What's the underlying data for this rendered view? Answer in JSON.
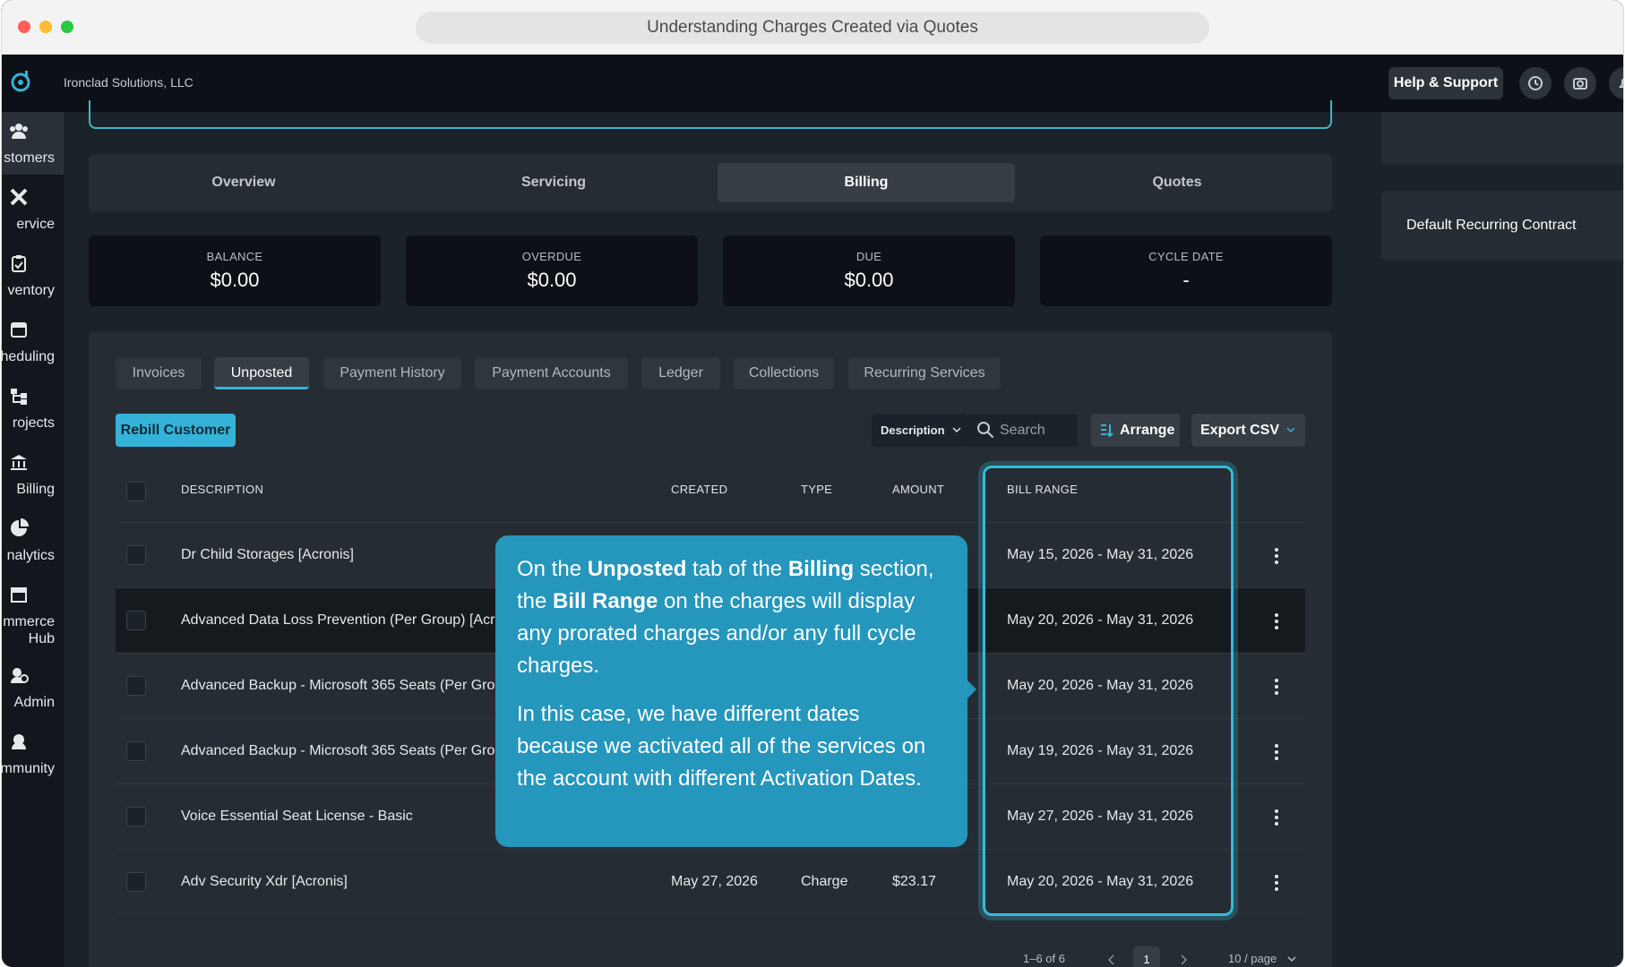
{
  "browser": {
    "title": "Understanding Charges Created via Quotes"
  },
  "header": {
    "company": "Ironclad Solutions, LLC",
    "help_label": "Help & Support",
    "icons": [
      "history-icon",
      "camera-icon",
      "notification-icon"
    ]
  },
  "sidebar": {
    "items": [
      {
        "label": "stomers",
        "icon": "customers-icon",
        "active": true
      },
      {
        "label": "ervice",
        "icon": "service-tools-icon"
      },
      {
        "label": "ventory",
        "icon": "inventory-clipboard-icon"
      },
      {
        "label": "heduling",
        "icon": "calendar-icon"
      },
      {
        "label": "rojects",
        "icon": "projects-hierarchy-icon"
      },
      {
        "label": "Billing",
        "icon": "bank-icon"
      },
      {
        "label": "nalytics",
        "icon": "pie-chart-icon"
      },
      {
        "label": "mmerce Hub",
        "icon": "store-icon"
      },
      {
        "label": "Admin",
        "icon": "admin-user-gear-icon"
      },
      {
        "label": "mmunity",
        "icon": "community-icon"
      }
    ]
  },
  "main_tabs": [
    {
      "label": "Overview"
    },
    {
      "label": "Servicing"
    },
    {
      "label": "Billing",
      "active": true
    },
    {
      "label": "Quotes"
    }
  ],
  "summary_cards": [
    {
      "label": "BALANCE",
      "value": "$0.00"
    },
    {
      "label": "OVERDUE",
      "value": "$0.00"
    },
    {
      "label": "DUE",
      "value": "$0.00"
    },
    {
      "label": "CYCLE DATE",
      "value": "-"
    }
  ],
  "sub_tabs": [
    {
      "label": "Invoices"
    },
    {
      "label": "Unposted",
      "active": true
    },
    {
      "label": "Payment History"
    },
    {
      "label": "Payment Accounts"
    },
    {
      "label": "Ledger"
    },
    {
      "label": "Collections"
    },
    {
      "label": "Recurring Services"
    }
  ],
  "toolbar": {
    "rebill_label": "Rebill Customer",
    "filter_field": "Description",
    "search_placeholder": "Search",
    "arrange_label": "Arrange",
    "export_label": "Export CSV"
  },
  "table": {
    "columns": [
      "DESCRIPTION",
      "CREATED",
      "TYPE",
      "AMOUNT",
      "BILL RANGE"
    ],
    "rows": [
      {
        "description": "Dr Child Storages [Acronis]",
        "created": "",
        "type": "",
        "amount": "",
        "bill_range": "May 15, 2026 - May 31, 2026"
      },
      {
        "description": "Advanced Data Loss Prevention (Per Group) [Acronis]",
        "created": "",
        "type": "",
        "amount": "",
        "bill_range": "May 20, 2026 - May 31, 2026"
      },
      {
        "description": "Advanced Backup - Microsoft 365 Seats (Per Group)",
        "created": "",
        "type": "",
        "amount": "",
        "bill_range": "May 20, 2026 - May 31, 2026"
      },
      {
        "description": "Advanced Backup - Microsoft 365 Seats (Per Group)",
        "created": "",
        "type": "",
        "amount": "",
        "bill_range": "May 19, 2026 - May 31, 2026"
      },
      {
        "description": "Voice Essential Seat License - Basic",
        "created": "",
        "type": "",
        "amount": "",
        "bill_range": "May 27, 2026 - May 31, 2026"
      },
      {
        "description": "Adv Security Xdr [Acronis]",
        "created": "May 27, 2026",
        "type": "Charge",
        "amount": "$23.17",
        "bill_range": "May 20, 2026 - May 31, 2026"
      }
    ]
  },
  "pagination": {
    "range": "1–6 of 6",
    "current_page": "1",
    "per_page": "10 / page"
  },
  "callout": {
    "p1_a": "On the ",
    "p1_b": "Unposted",
    "p1_c": " tab of the ",
    "p1_d": "Billing",
    "p1_e": " section, the ",
    "p1_f": "Bill Range",
    "p1_g": " on the charges will display any prorated charges and/or any full cycle charges.",
    "p2": "In this case, we have different dates because we activated all of the services on the account with different Activation Dates."
  },
  "right_panel": {
    "contract_label": "Default Recurring Contract"
  },
  "colors": {
    "accent": "#35b2d7",
    "callout": "#2596bc",
    "highlight": "#32bdda"
  }
}
